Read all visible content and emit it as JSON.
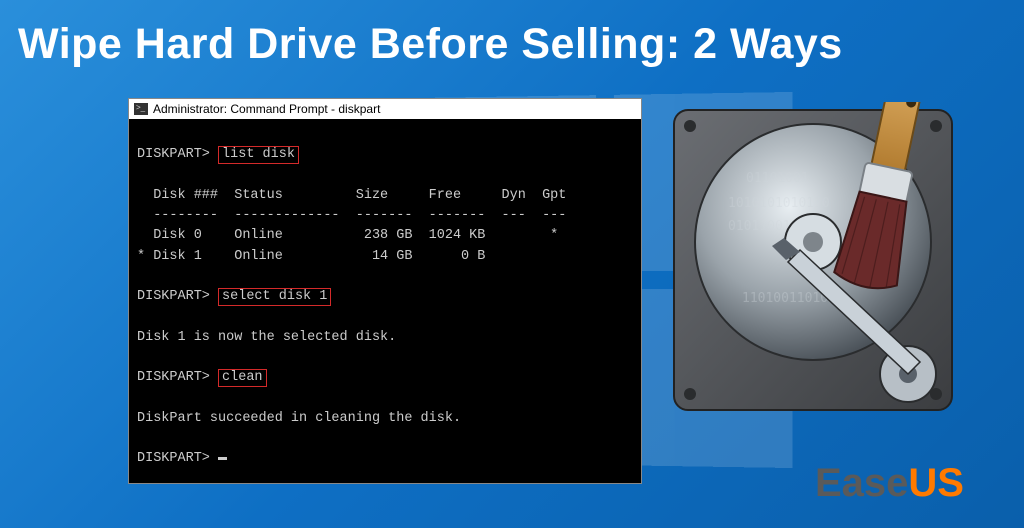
{
  "headline": "Wipe Hard Drive Before Selling: 2 Ways",
  "cmd": {
    "title": "Administrator: Command Prompt - diskpart",
    "prompt": "DISKPART>",
    "cmd1": "list disk",
    "header": "  Disk ###  Status         Size     Free     Dyn  Gpt",
    "divider": "  --------  -------------  -------  -------  ---  ---",
    "row0": "  Disk 0    Online          238 GB  1024 KB        *",
    "row1": "* Disk 1    Online           14 GB      0 B",
    "cmd2": "select disk 1",
    "resp2": "Disk 1 is now the selected disk.",
    "cmd3": "clean",
    "resp3": "DiskPart succeeded in cleaning the disk."
  },
  "brand": {
    "ease": "Ease",
    "us": "US"
  }
}
